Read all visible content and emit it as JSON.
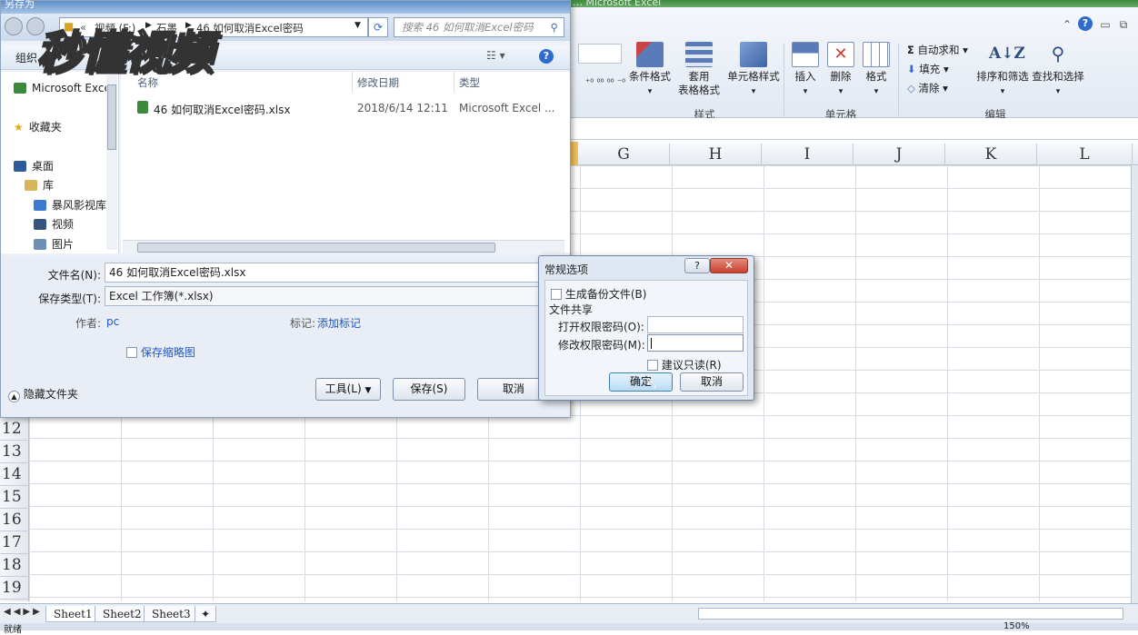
{
  "excel": {
    "title": "… Microsoft Excel",
    "ribbon": {
      "conditional_format": "条件格式",
      "table_format_line1": "套用",
      "table_format_line2": "表格格式",
      "cell_styles": "单元格样式",
      "insert": "插入",
      "delete": "删除",
      "format": "格式",
      "autosum": "自动求和",
      "fill": "填充",
      "clear": "清除",
      "sort_filter": "排序和筛选",
      "find_select": "查找和选择",
      "group_style": "样式",
      "group_cells": "单元格",
      "group_edit": "编辑"
    },
    "columns": [
      "G",
      "H",
      "I",
      "J",
      "K",
      "L"
    ],
    "rows": [
      "12",
      "13",
      "14",
      "15",
      "16",
      "17",
      "18",
      "19"
    ],
    "sheets": [
      "Sheet1",
      "Sheet2",
      "Sheet3"
    ],
    "status": "就绪",
    "zoom": "150%"
  },
  "save_dialog": {
    "title": "另存为",
    "breadcrumb": [
      "视频 (F:)",
      "石墨",
      "46 如何取消Excel密码"
    ],
    "search_placeholder": "搜索 46 如何取消Excel密码",
    "organize": "组织",
    "nav": {
      "excel": "Microsoft Excel",
      "favorites": "收藏夹",
      "desktop": "桌面",
      "library": "库",
      "storm_library": "暴风影视库",
      "videos": "视频",
      "pictures": "图片"
    },
    "columns": {
      "name": "名称",
      "modified": "修改日期",
      "type": "类型"
    },
    "file": {
      "name": "46 如何取消Excel密码.xlsx",
      "modified": "2018/6/14 12:11",
      "type": "Microsoft Excel ..."
    },
    "filename_label": "文件名(N):",
    "filename_value": "46 如何取消Excel密码.xlsx",
    "filetype_label": "保存类型(T):",
    "filetype_value": "Excel 工作簿(*.xlsx)",
    "author_label": "作者:",
    "author_value": "pc",
    "tags_label": "标记:",
    "tags_value": "添加标记",
    "thumbnail_label": "保存缩略图",
    "hide_folders": "隐藏文件夹",
    "tools": "工具(L)",
    "save": "保存(S)",
    "cancel": "取消"
  },
  "options_dialog": {
    "title": "常规选项",
    "backup": "生成备份文件(B)",
    "sharing": "文件共享",
    "open_password_label": "打开权限密码(O):",
    "modify_password_label": "修改权限密码(M):",
    "read_only": "建议只读(R)",
    "ok": "确定",
    "cancel": "取消"
  },
  "watermark": "秒懂视频",
  "colors": {
    "accent": "#1f57c3",
    "excel_green": "#3c8a3c",
    "close_red": "#c9402f"
  }
}
